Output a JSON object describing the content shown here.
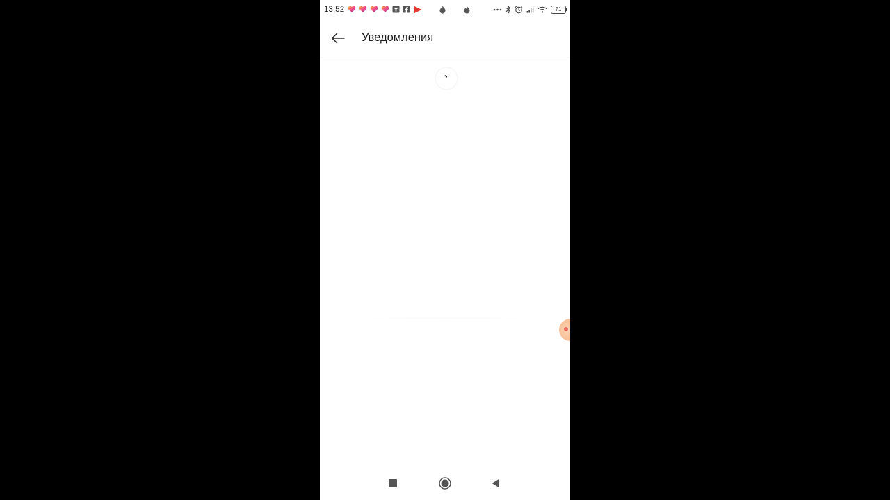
{
  "status_bar": {
    "time": "13:52",
    "battery": "71",
    "notification_icons": [
      "heart-gradient-icon",
      "heart-gradient-icon",
      "heart-gradient-icon",
      "heart-gradient-icon",
      "upload-box-icon",
      "facebook-icon",
      "play-red-icon",
      "flame-icon",
      "flame-icon"
    ],
    "system_icons": [
      "more-dots-icon",
      "bluetooth-icon",
      "alarm-icon",
      "signal-icon",
      "wifi-icon",
      "battery-icon"
    ]
  },
  "app_bar": {
    "back_icon": "arrow-left-icon",
    "title": "Уведомления"
  },
  "content": {
    "state": "loading",
    "spinner_icon": "loading-spinner-icon"
  },
  "nav_bar": {
    "items": [
      "recents-square-icon",
      "home-circle-icon",
      "back-triangle-icon"
    ]
  },
  "colors": {
    "background": "#ffffff",
    "accent_red": "#e53935",
    "bubble": "#f8c29a"
  }
}
